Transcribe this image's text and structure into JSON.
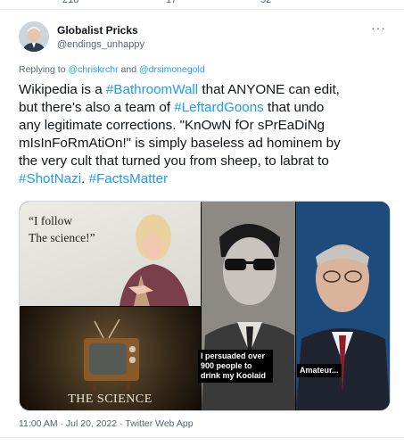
{
  "top_stats": {
    "retweets": "218",
    "quotes": "17",
    "likes": "52"
  },
  "tweet": {
    "author_name": "Globalist Pricks",
    "author_handle": "@endings_unhappy",
    "more_icon": "more-horizontal-icon",
    "reply_prefix": "Replying to",
    "reply_mention_1": "@chriskrchr",
    "reply_and": "and",
    "reply_mention_2": "@drsimonegold",
    "lines": [
      [
        {
          "t": "Wikipedia is a "
        },
        {
          "t": "#BathroomWall",
          "h": true
        },
        {
          "t": " that ANYONE can edit,"
        }
      ],
      [
        {
          "t": "but there's also a team of "
        },
        {
          "t": "#LeftardGoons",
          "h": true
        },
        {
          "t": " that undo"
        }
      ],
      [
        {
          "t": "any legitimate corrections. \"KnOwN fOr sPrEaDiNg"
        }
      ],
      [
        {
          "t": "mIsInFoRmAtiOn!\" is simply baseless ad hominem by"
        }
      ],
      [
        {
          "t": "the very cult that turned you from sheep, to labrat to"
        }
      ],
      [
        {
          "t": "#ShotNazi",
          "h": true
        },
        {
          "t": ". "
        },
        {
          "t": "#FactsMatter",
          "h": true
        }
      ]
    ],
    "media": {
      "image1_text_line1": "“I follow",
      "image1_text_line2": "The science!”",
      "image2_text": "THE SCIENCE",
      "image3_caption": "I persuaded over 900 people to drink my Koolaid",
      "image4_caption": "Amateur..."
    },
    "timestamp": "11:00 AM · Jul 20, 2022 · ",
    "source_app": "Twitter Web App"
  },
  "colors": {
    "accent": "#1d9bf0",
    "muted": "#536471",
    "text": "#0f1419"
  }
}
